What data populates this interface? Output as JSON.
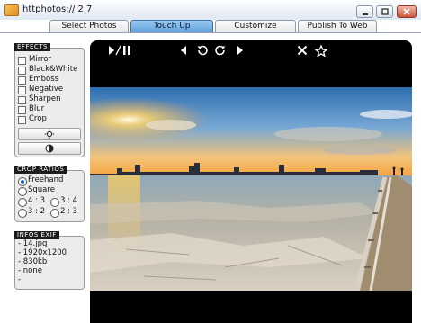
{
  "window": {
    "title": "httphotos:// 2.7",
    "min_icon": "minimize-icon",
    "max_icon": "maximize-icon",
    "close_icon": "close-icon"
  },
  "tabs": [
    {
      "label": "Select Photos",
      "active": false
    },
    {
      "label": "Touch Up",
      "active": true
    },
    {
      "label": "Customize Template",
      "active": false
    },
    {
      "label": "Publish To Web",
      "active": false
    }
  ],
  "effects": {
    "title": "EFFECTS",
    "items": [
      {
        "label": "Mirror",
        "checked": false
      },
      {
        "label": "Black&White",
        "checked": false
      },
      {
        "label": "Emboss",
        "checked": false
      },
      {
        "label": "Negative",
        "checked": false
      },
      {
        "label": "Sharpen",
        "checked": false
      },
      {
        "label": "Blur",
        "checked": false
      },
      {
        "label": "Crop",
        "checked": false
      }
    ],
    "brightness_icon": "brightness-icon",
    "contrast_icon": "contrast-icon"
  },
  "crop_ratios": {
    "title": "CROP RATIOS",
    "options": [
      {
        "label": "Freehand",
        "selected": true
      },
      {
        "label": "Square",
        "selected": false
      },
      {
        "label": "4 : 3",
        "selected": false
      },
      {
        "label": "3 : 4",
        "selected": false
      },
      {
        "label": "3 : 2",
        "selected": false
      },
      {
        "label": "2 : 3",
        "selected": false
      }
    ]
  },
  "exif": {
    "title": "INFOS EXIF",
    "lines": [
      "- 14.jpg",
      "- 1920x1200",
      "- 830kb",
      "- none",
      "-"
    ]
  },
  "viewer_toolbar": {
    "play_pause": "play-pause-icon",
    "prev": "previous-icon",
    "rotate_left": "rotate-left-icon",
    "rotate_right": "rotate-right-icon",
    "next": "next-icon",
    "delete": "delete-icon",
    "favorite": "star-icon"
  },
  "colors": {
    "active_tab": "#5e9fdc",
    "panel_bg": "#ececec",
    "viewer_bg": "#000000"
  }
}
